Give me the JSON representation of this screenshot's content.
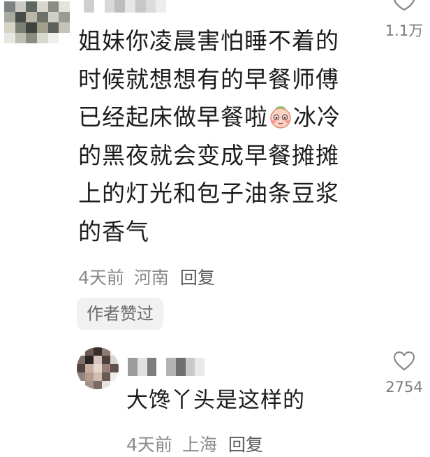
{
  "comment": {
    "text_lines": [
      "姐妹你凌晨害怕睡不着的",
      "时候就想想有的早餐师傅",
      "已经起床做早餐啦",
      "冰冷",
      "的黑夜就会变成早餐摊摊",
      "上的灯光和包子油条豆浆",
      "的香气"
    ],
    "emoji": "shy-face-emoji",
    "time": "4天前",
    "location": "河南",
    "reply_label": "回复",
    "author_liked_badge": "作者赞过",
    "like_count": "1.1万"
  },
  "reply": {
    "text": "大馋丫头是这样的",
    "time": "4天前",
    "location": "上海",
    "reply_label": "回复",
    "like_count": "2754"
  },
  "icons": {
    "like": "heart-outline-icon"
  },
  "colors": {
    "text": "#1c1c1c",
    "meta": "#8a8a8a",
    "badge_bg": "#f1f1f1"
  }
}
